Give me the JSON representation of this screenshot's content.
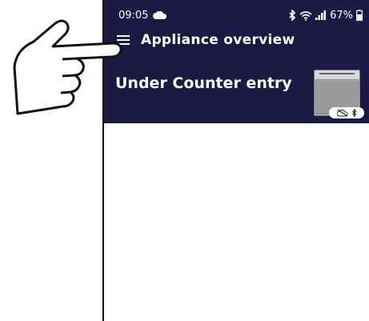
{
  "status_bar": {
    "time": "09:05",
    "battery": "67%",
    "icons": [
      "cloud-icon",
      "bluetooth-icon",
      "wifi-icon",
      "signal-icon",
      "battery-icon"
    ]
  },
  "toolbar": {
    "menu_icon": "hamburger-menu-icon",
    "title": "Appliance overview"
  },
  "appliance": {
    "name": "Under Counter entry",
    "image": "dishwasher-image",
    "status_icons": [
      "cloud-off-icon",
      "bluetooth-icon"
    ]
  },
  "colors": {
    "header_bg": "#1b1a45",
    "header_text": "#ffffff"
  }
}
